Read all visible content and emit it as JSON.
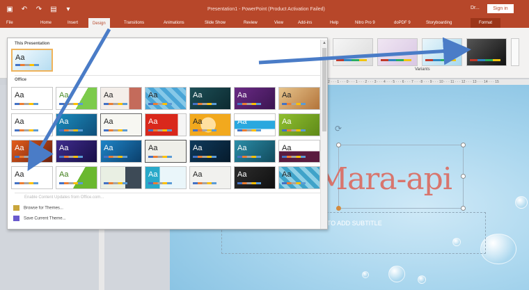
{
  "window": {
    "title": "Presentation1  -  PowerPoint (Product Activation Failed)",
    "account": "Dr...",
    "signin_label": "Sign in"
  },
  "ribbon": {
    "tabs": [
      "File",
      "Home",
      "Insert",
      "Design",
      "Transitions",
      "Animations",
      "Slide Show",
      "Review",
      "View",
      "Add-ins",
      "Help",
      "Nitro Pro 9",
      "doPDF 9",
      "Storyboarding",
      "Format"
    ],
    "active_tab": "Design",
    "variants_label": "Variants"
  },
  "dropdown": {
    "section_this": "This Presentation",
    "section_office": "Office",
    "thumb_text": "Aa",
    "menu": {
      "enable_updates": "Enable Content Updates from Office.com...",
      "browse": "Browse for Themes...",
      "save": "Save Current Theme..."
    }
  },
  "slide": {
    "title": "Mara-api",
    "subtitle": "CK TO ADD SUBTITLE"
  },
  "colors": {
    "accent": "#b7472a",
    "arrow": "#4a7cc7"
  }
}
